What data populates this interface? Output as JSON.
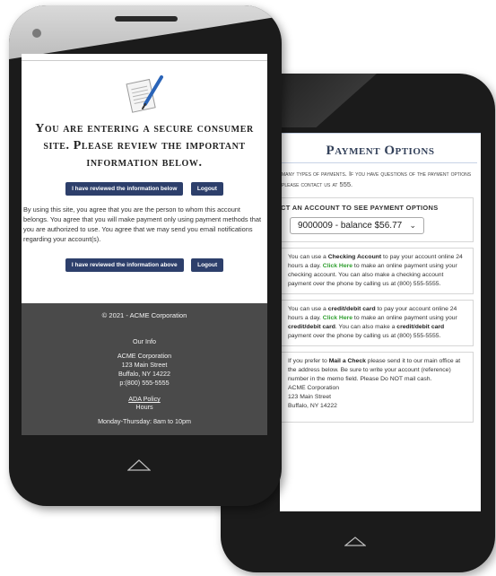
{
  "back_phone": {
    "title": "Payment Options",
    "intro": "many types of payments. If you have questions of the payment options please contact us at 555.",
    "account_label": "ct an account to see payment options",
    "account_select": "9000009 - balance $56.77",
    "checking": {
      "t1": "You can use a ",
      "b1": "Checking Account",
      "t2": " to pay your account online 24 hours a day. ",
      "link": "Click Here",
      "t3": " to make an online payment using your checking account. You can also make a checking account payment over the phone by calling us at (800) 555-5555."
    },
    "card": {
      "t1": "You can use a ",
      "b1": "credit/debit card",
      "t2": " to pay your account online 24 hours a day. ",
      "link": "Click Here",
      "t3": " to make an online payment using your ",
      "b2": "credit/debit card",
      "t4": ". You can also make a ",
      "b3": "credit/debit card",
      "t5": " payment over the phone by calling us at (800) 555-5555."
    },
    "check": {
      "t1": "If you prefer to ",
      "b1": "Mail a Check",
      "t2": " please send it to our main office at the address below. Be sure to write your account (reference) number in the memo field. Please Do NOT mail cash.",
      "l1": "ACME Corporation",
      "l2": "123 Main Street",
      "l3": "Buffalo, NY 14222"
    }
  },
  "front_phone": {
    "title": "You are entering a secure consumer site. Please review the important information below.",
    "btn_reviewed_below": "I have reviewed the information below",
    "btn_logout": "Logout",
    "agreement": "By using this site, you agree that you are the person to whom this account belongs. You agree that you will make payment only using payment methods that you are authorized to use. You agree that we may send you email notifications regarding your account(s).",
    "btn_reviewed_above": "I have reviewed the information above",
    "footer": {
      "copyright": "© 2021 - ACME Corporation",
      "our_info": "Our Info",
      "company": "ACME Corporation",
      "street": "123 Main Street",
      "city": "Buffalo, NY 14222",
      "phone": "p:(800) 555-5555",
      "ada": "ADA Policy",
      "hours_label": "Hours",
      "hours_weekday": "Monday-Thursday: 8am to 10pm"
    }
  },
  "colors": {
    "button_bg": "#2d3f6b",
    "link_green": "#2f9e2f",
    "footer_bg": "#4a4a4a",
    "title_blue": "#33415a"
  },
  "icons": [
    "document-pen-icon",
    "home-button-icon",
    "camera-icon",
    "speaker-icon"
  ]
}
